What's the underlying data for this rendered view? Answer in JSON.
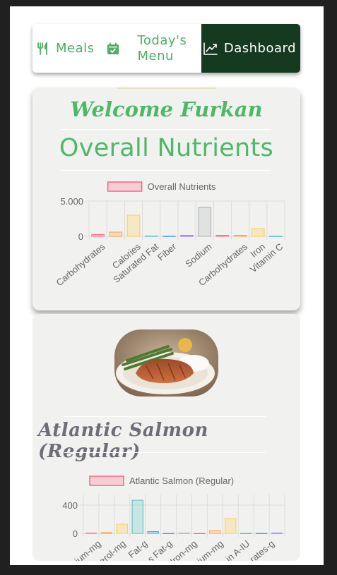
{
  "nav": {
    "meals_label": "Meals",
    "menu_label_1": "Today's",
    "menu_label_2": "Menu",
    "dashboard_label": "Dashboard",
    "meals_icon": "utensils-icon",
    "menu_icon": "calendar-icon",
    "dashboard_icon": "trending-chart-icon"
  },
  "welcome_text": "Welcome Furkan",
  "overall_title": "Overall Nutrients",
  "food": {
    "name": "Atlantic Salmon (Regular)"
  },
  "colors": {
    "accent_green": "#4fb868",
    "dark_green": "#163a20"
  },
  "chart_data": [
    {
      "type": "bar",
      "legend": "Overall Nutrients",
      "categories": [
        "Carbohydrates",
        "Calories",
        "Saturated Fat",
        "Fiber",
        "Sodium",
        "Carbohydrates",
        "Iron",
        "Vitamin C"
      ],
      "values": [
        250,
        600,
        3000,
        50,
        30,
        120,
        4100,
        150,
        150,
        1100,
        30
      ],
      "bar_labels": [
        "Carbohydrates",
        "",
        "Calories",
        "",
        "Saturated Fat",
        "Fiber",
        "",
        "Sodium",
        "",
        "Carbohydrates",
        "",
        "Iron",
        "Vitamin C"
      ],
      "ylim": [
        0,
        5000
      ],
      "yticks": [
        "5.000",
        "0"
      ],
      "legend_position": "top"
    },
    {
      "type": "bar",
      "legend": "Atlantic Salmon (Regular)",
      "categories": [
        "Sodium-mg",
        "Cholesterol-mg",
        "Fat-g",
        "Trans Fat-g",
        "Iron-mg",
        "Potassium-mg",
        "Vitamin A-IU",
        "Carbohydrates-g"
      ],
      "tick_labels": [
        "ium-mg",
        "terol-mg",
        "Fat-g",
        "s Fat-g",
        "Iron-mg",
        "ium-mg",
        "in A-IU",
        "rates-g"
      ],
      "values": [
        5,
        10,
        130,
        470,
        25,
        0,
        5,
        0,
        40,
        210,
        0,
        0,
        5
      ],
      "ylim": [
        0,
        550
      ],
      "yticks": [
        "400",
        "0"
      ],
      "legend_position": "top"
    }
  ]
}
